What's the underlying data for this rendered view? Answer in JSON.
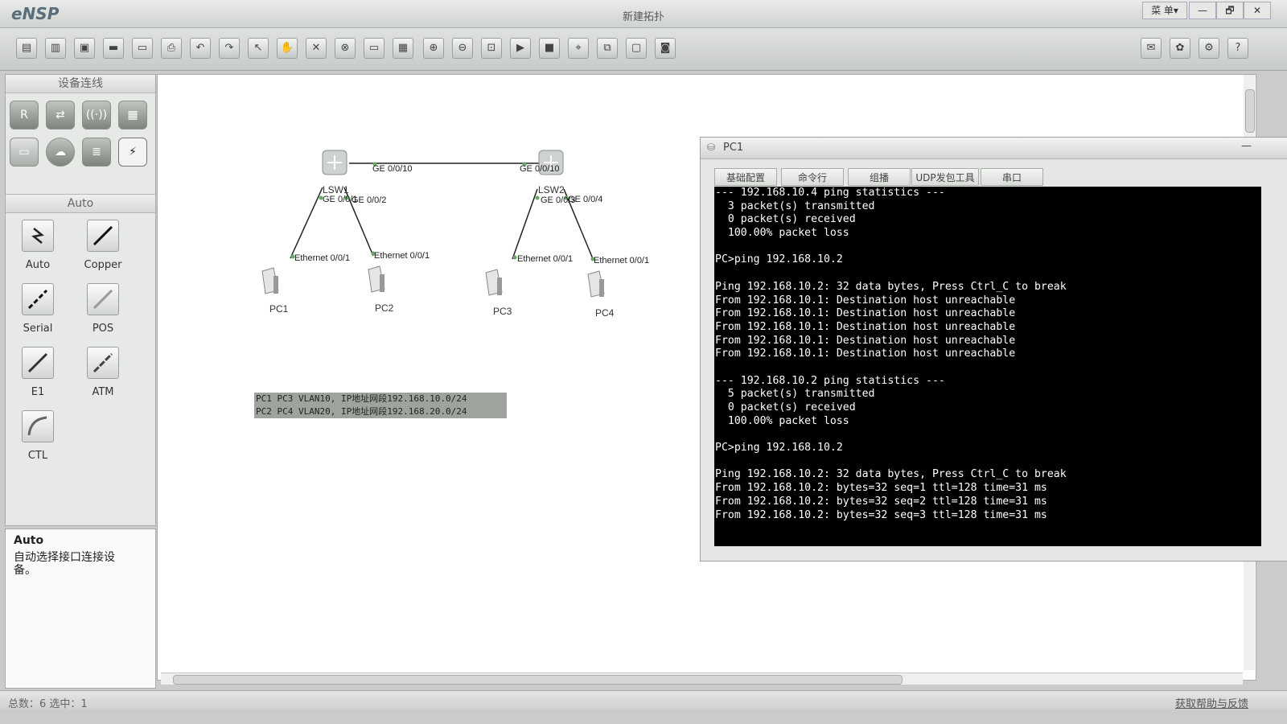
{
  "app": {
    "logo": "eNSP",
    "window_title": "新建拓扑",
    "menu_label": "菜 单▾"
  },
  "window_controls": {
    "minimize": "—",
    "restore": "🗗",
    "close": "✕"
  },
  "left_panel": {
    "devices_header": "设备连线",
    "auto_header": "Auto",
    "device_icons": [
      "R",
      "⇄",
      "((·))",
      "▦",
      "▭",
      "☁",
      "≣",
      "⚡"
    ],
    "cables": [
      {
        "label": "Auto",
        "icon": "auto-cable-icon"
      },
      {
        "label": "Copper",
        "icon": "copper-cable-icon"
      },
      {
        "label": "Serial",
        "icon": "serial-cable-icon"
      },
      {
        "label": "POS",
        "icon": "pos-cable-icon"
      },
      {
        "label": "E1",
        "icon": "e1-cable-icon"
      },
      {
        "label": "ATM",
        "icon": "atm-cable-icon"
      },
      {
        "label": "CTL",
        "icon": "ctl-cable-icon"
      }
    ]
  },
  "description": {
    "title": "Auto",
    "text": "自动选择接口连接设备。"
  },
  "topology": {
    "switches": [
      {
        "name": "LSW1"
      },
      {
        "name": "LSW2"
      }
    ],
    "pcs": [
      {
        "name": "PC1"
      },
      {
        "name": "PC2"
      },
      {
        "name": "PC3"
      },
      {
        "name": "PC4"
      }
    ],
    "ports": {
      "lsw1_uplink": "GE 0/0/10",
      "lsw2_uplink": "GE 0/0/10",
      "lsw1_p1": "GE 0/0/1",
      "lsw1_p2": "GE 0/0/2",
      "lsw2_p3": "GE 0/0/3",
      "lsw2_p4": "GE 0/0/4",
      "pc1_port": "Ethernet 0/0/1",
      "pc2_port": "Ethernet 0/0/1",
      "pc3_port": "Ethernet 0/0/1",
      "pc4_port": "Ethernet 0/0/1"
    },
    "note": [
      "PC1 PC3 VLAN10, IP地址网段192.168.10.0/24",
      "PC2 PC4 VLAN20, IP地址网段192.168.20.0/24"
    ]
  },
  "pc1_window": {
    "title": "PC1",
    "tabs": [
      "基础配置",
      "命令行",
      "组播",
      "UDP发包工具",
      "串口"
    ],
    "terminal_lines": [
      "--- 192.168.10.4 ping statistics ---",
      "  3 packet(s) transmitted",
      "  0 packet(s) received",
      "  100.00% packet loss",
      "",
      "PC>ping 192.168.10.2",
      "",
      "Ping 192.168.10.2: 32 data bytes, Press Ctrl_C to break",
      "From 192.168.10.1: Destination host unreachable",
      "From 192.168.10.1: Destination host unreachable",
      "From 192.168.10.1: Destination host unreachable",
      "From 192.168.10.1: Destination host unreachable",
      "From 192.168.10.1: Destination host unreachable",
      "",
      "--- 192.168.10.2 ping statistics ---",
      "  5 packet(s) transmitted",
      "  0 packet(s) received",
      "  100.00% packet loss",
      "",
      "PC>ping 192.168.10.2",
      "",
      "Ping 192.168.10.2: 32 data bytes, Press Ctrl_C to break",
      "From 192.168.10.2: bytes=32 seq=1 ttl=128 time=31 ms",
      "From 192.168.10.2: bytes=32 seq=2 ttl=128 time=31 ms",
      "From 192.168.10.2: bytes=32 seq=3 ttl=128 time=31 ms"
    ]
  },
  "status": {
    "left": "总数：6 选中：1",
    "right": "获取帮助与反馈"
  }
}
